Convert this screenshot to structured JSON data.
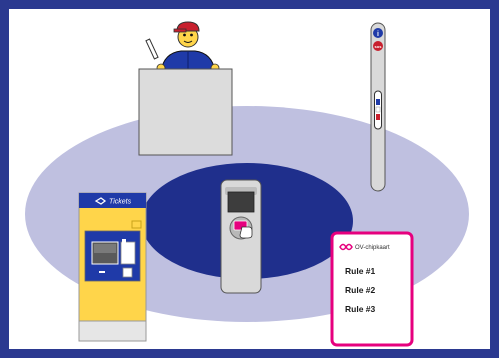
{
  "scene": {
    "colors": {
      "border": "#2b3990",
      "outer_ring": "#bfc0e0",
      "inner_ring": "#1f2f8c",
      "ticket_machine": "#ffd54a",
      "card_border": "#e6007e"
    }
  },
  "ticket_machine": {
    "header_label": "Tickets"
  },
  "info_card": {
    "title": "OV-chipkaart",
    "rules": [
      "Rule #1",
      "Rule #2",
      "Rule #3"
    ]
  },
  "help_pole": {
    "info_symbol": "i",
    "sos_label": "sos"
  }
}
